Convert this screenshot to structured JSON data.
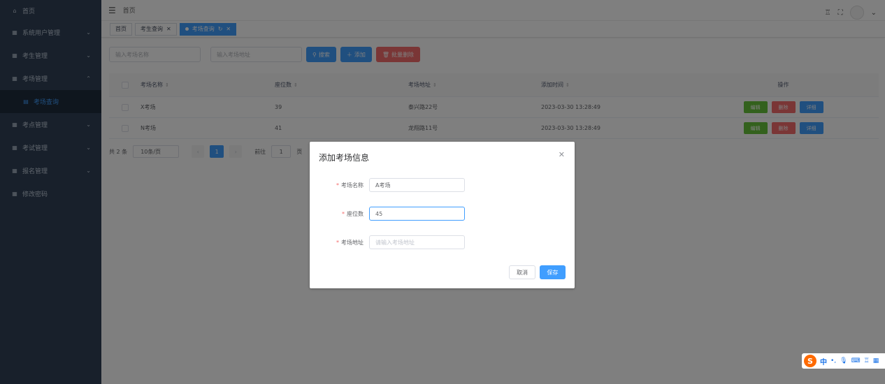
{
  "sidebar": {
    "items": [
      {
        "label": "首页",
        "icon": "home-icon",
        "glyph": "⌂",
        "arrow": ""
      },
      {
        "label": "系统用户管理",
        "icon": "grid-icon",
        "glyph": "▦",
        "arrow": "⌄"
      },
      {
        "label": "考生管理",
        "icon": "grid-icon",
        "glyph": "▦",
        "arrow": "⌄"
      },
      {
        "label": "考场管理",
        "icon": "grid-icon",
        "glyph": "▦",
        "arrow": "⌃"
      },
      {
        "label": "考场查询",
        "icon": "list-icon",
        "glyph": "▤",
        "arrow": ""
      },
      {
        "label": "考点管理",
        "icon": "grid-icon",
        "glyph": "▦",
        "arrow": "⌄"
      },
      {
        "label": "考试管理",
        "icon": "grid-icon",
        "glyph": "▦",
        "arrow": "⌄"
      },
      {
        "label": "报名管理",
        "icon": "grid-icon",
        "glyph": "▦",
        "arrow": "⌄"
      },
      {
        "label": "修改密码",
        "icon": "grid-icon",
        "glyph": "▦",
        "arrow": ""
      }
    ]
  },
  "navbar": {
    "breadcrumb": "首页"
  },
  "tags": [
    {
      "label": "首页"
    },
    {
      "label": "考生查询"
    },
    {
      "label": "考场查询"
    }
  ],
  "search": {
    "name_placeholder": "输入考场名称",
    "address_placeholder": "输入考场地址",
    "search_label": "搜索",
    "add_label": "添加",
    "batch_delete_label": "批量删除"
  },
  "table": {
    "headers": [
      "考场名称",
      "座位数",
      "考场地址",
      "添加时间",
      "操作"
    ],
    "rows": [
      {
        "name": "X考场",
        "seats": "39",
        "address": "泰兴路22号",
        "time": "2023-03-30 13:28:49"
      },
      {
        "name": "N考场",
        "seats": "41",
        "address": "龙翔路11号",
        "time": "2023-03-30 13:28:49"
      }
    ],
    "actions": {
      "edit": "编辑",
      "delete": "删除",
      "detail": "详细"
    }
  },
  "pagination": {
    "total": "共 2 条",
    "page_size": "10条/页",
    "current": "1",
    "goto_label": "前往",
    "goto_value": "1",
    "page_suffix": "页"
  },
  "dialog": {
    "title": "添加考场信息",
    "fields": [
      {
        "label": "考场名称",
        "value": "A考场"
      },
      {
        "label": "座位数",
        "value": "45"
      },
      {
        "label": "考场地址",
        "placeholder": "请输入考场地址"
      }
    ],
    "cancel_label": "取消",
    "save_label": "保存"
  },
  "ime": {
    "logo": "S",
    "lang": "中"
  },
  "colors": {
    "primary": "#409eff",
    "danger": "#f56c6c",
    "success": "#67c23a",
    "sidebar": "#304156"
  }
}
